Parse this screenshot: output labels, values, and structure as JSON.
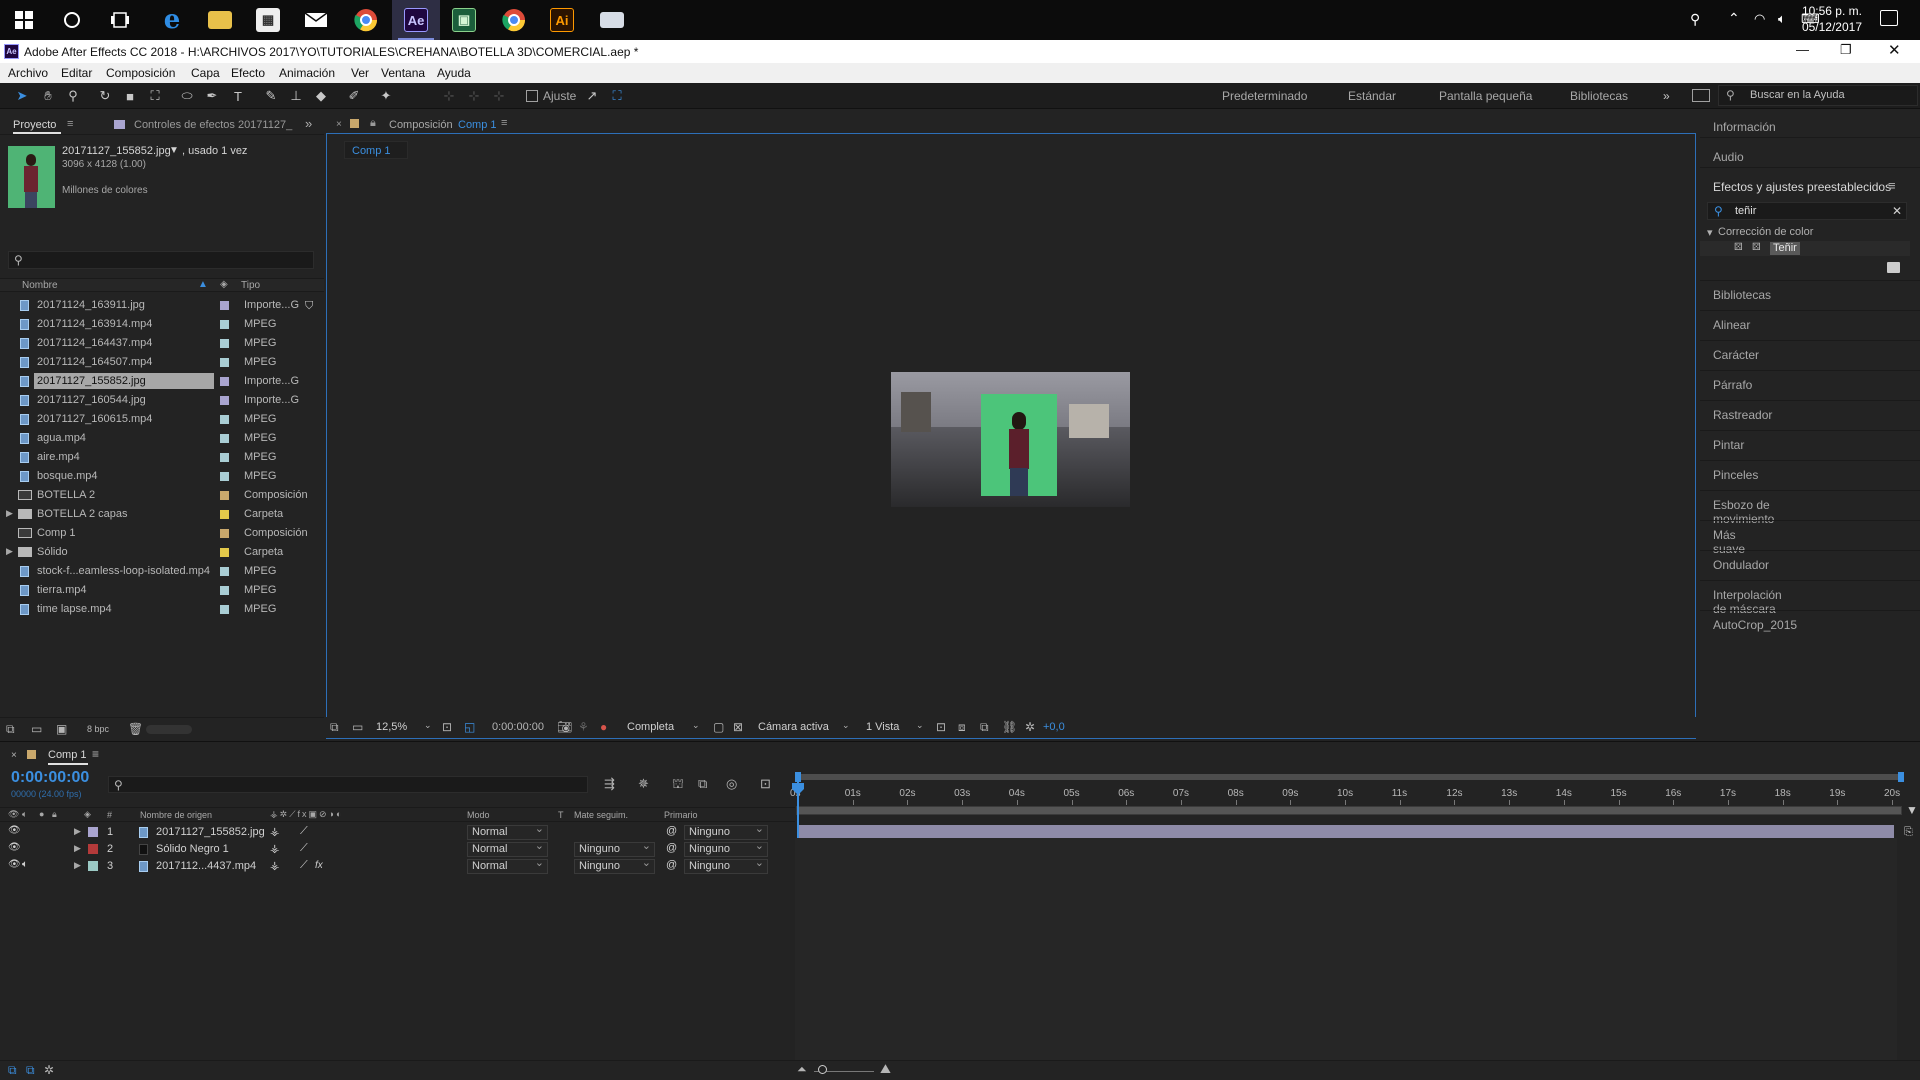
{
  "taskbar": {
    "icons": [
      "windows-start-icon",
      "cortana-icon",
      "task-view-icon",
      "edge-icon",
      "file-explorer-icon",
      "store-icon",
      "mail-icon",
      "chrome-icon",
      "after-effects-icon",
      "camtasia-icon",
      "chrome-icon",
      "illustrator-icon",
      "network-drive-icon"
    ],
    "after_effects_label": "Ae",
    "illustrator_label": "Ai",
    "time": "10:56 p. m.",
    "date": "05/12/2017"
  },
  "window": {
    "title": "Adobe After Effects CC 2018 - H:\\ARCHIVOS 2017\\YO\\TUTORIALES\\CREHANA\\BOTELLA 3D\\COMERCIAL.aep *",
    "app_icon_label": "Ae"
  },
  "menu": [
    "Archivo",
    "Editar",
    "Composición",
    "Capa",
    "Efecto",
    "Animación",
    "Ver",
    "Ventana",
    "Ayuda"
  ],
  "toolbar": {
    "snap_label": "Ajuste",
    "workspaces": [
      "Predeterminado",
      "Estándar",
      "Pantalla pequeña",
      "Bibliotecas"
    ],
    "search_placeholder": "Buscar en la Ayuda"
  },
  "project_panel": {
    "tab_project": "Proyecto",
    "tab_effects": "Controles de efectos 20171127_",
    "preview_name": "20171127_155852.jpg",
    "preview_used": ", usado 1 vez",
    "preview_dims": "3096 x 4128 (1.00)",
    "preview_colors": "Millones de colores",
    "col_name": "Nombre",
    "col_type": "Tipo",
    "bpc": "8 bpc",
    "items": [
      {
        "name": "20171124_163911.jpg",
        "type": "Importe...G",
        "label_color": "#a9a4cf",
        "kind": "file",
        "selected": false
      },
      {
        "name": "20171124_163914.mp4",
        "type": "MPEG",
        "label_color": "#a9cdd4",
        "kind": "file",
        "selected": false
      },
      {
        "name": "20171124_164437.mp4",
        "type": "MPEG",
        "label_color": "#a9cdd4",
        "kind": "file",
        "selected": false
      },
      {
        "name": "20171124_164507.mp4",
        "type": "MPEG",
        "label_color": "#a9cdd4",
        "kind": "file",
        "selected": false
      },
      {
        "name": "20171127_155852.jpg",
        "type": "Importe...G",
        "label_color": "#a9a4cf",
        "kind": "file",
        "selected": true
      },
      {
        "name": "20171127_160544.jpg",
        "type": "Importe...G",
        "label_color": "#a9a4cf",
        "kind": "file",
        "selected": false
      },
      {
        "name": "20171127_160615.mp4",
        "type": "MPEG",
        "label_color": "#a9cdd4",
        "kind": "file",
        "selected": false
      },
      {
        "name": "agua.mp4",
        "type": "MPEG",
        "label_color": "#a9cdd4",
        "kind": "file",
        "selected": false
      },
      {
        "name": "aire.mp4",
        "type": "MPEG",
        "label_color": "#a9cdd4",
        "kind": "file",
        "selected": false
      },
      {
        "name": "bosque.mp4",
        "type": "MPEG",
        "label_color": "#a9cdd4",
        "kind": "file",
        "selected": false
      },
      {
        "name": "BOTELLA 2",
        "type": "Composición",
        "label_color": "#c9a86c",
        "kind": "comp",
        "selected": false
      },
      {
        "name": "BOTELLA 2 capas",
        "type": "Carpeta",
        "label_color": "#e3c94a",
        "kind": "folder",
        "selected": false
      },
      {
        "name": "Comp 1",
        "type": "Composición",
        "label_color": "#c9a86c",
        "kind": "comp",
        "selected": false
      },
      {
        "name": "Sólido",
        "type": "Carpeta",
        "label_color": "#e3c94a",
        "kind": "folder",
        "selected": false
      },
      {
        "name": "stock-f...eamless-loop-isolated.mp4",
        "type": "MPEG",
        "label_color": "#a9cdd4",
        "kind": "file",
        "selected": false
      },
      {
        "name": "tierra.mp4",
        "type": "MPEG",
        "label_color": "#a9cdd4",
        "kind": "file",
        "selected": false
      },
      {
        "name": "time lapse.mp4",
        "type": "MPEG",
        "label_color": "#a9cdd4",
        "kind": "file",
        "selected": false
      }
    ]
  },
  "comp_panel": {
    "prefix": "Composición",
    "comp_name": "Comp 1",
    "subtab": "Comp 1",
    "zoom": "12,5%",
    "timecode": "0:00:00:00",
    "resolution": "Completa",
    "camera": "Cámara activa",
    "views": "1 Vista",
    "exposure": "+0,0"
  },
  "right_panel": {
    "info": "Información",
    "audio": "Audio",
    "effects_title": "Efectos y ajustes preestablecidos",
    "search_value": "teñir",
    "category": "Corrección de color",
    "effect": "Teñir",
    "items": [
      "Bibliotecas",
      "Alinear",
      "Carácter",
      "Párrafo",
      "Rastreador",
      "Pintar",
      "Pinceles",
      "Esbozo de movimiento",
      "Más suave",
      "Ondulador",
      "Interpolación de máscara",
      "AutoCrop_2015"
    ]
  },
  "timeline": {
    "tab": "Comp 1",
    "timecode": "0:00:00:00",
    "frames": "00000 (24.00 fps)",
    "col_num": "#",
    "col_source": "Nombre de origen",
    "col_mode": "Modo",
    "col_t": "T",
    "col_matte": "Mate seguim.",
    "col_parent": "Primario",
    "ticks": [
      "0s",
      "01s",
      "02s",
      "03s",
      "04s",
      "05s",
      "06s",
      "07s",
      "08s",
      "09s",
      "10s",
      "11s",
      "12s",
      "13s",
      "14s",
      "15s",
      "16s",
      "17s",
      "18s",
      "19s",
      "20s"
    ],
    "layers": [
      {
        "num": "1",
        "name": "20171127_155852.jpg",
        "mode": "Normal",
        "matte": "",
        "parent": "Ninguno",
        "label_color": "#a9a4cf",
        "bar_color": "#8e8ba8",
        "fx": ""
      },
      {
        "num": "2",
        "name": "Sólido Negro 1",
        "mode": "Normal",
        "matte": "Ninguno",
        "parent": "Ninguno",
        "label_color": "#b43a3a",
        "bar_color": "#a84444",
        "fx": ""
      },
      {
        "num": "3",
        "name": "2017112...4437.mp4",
        "mode": "Normal",
        "matte": "Ninguno",
        "parent": "Ninguno",
        "label_color": "#9bc9c4",
        "bar_color": "#7e9e9a",
        "fx": "fx"
      }
    ]
  }
}
